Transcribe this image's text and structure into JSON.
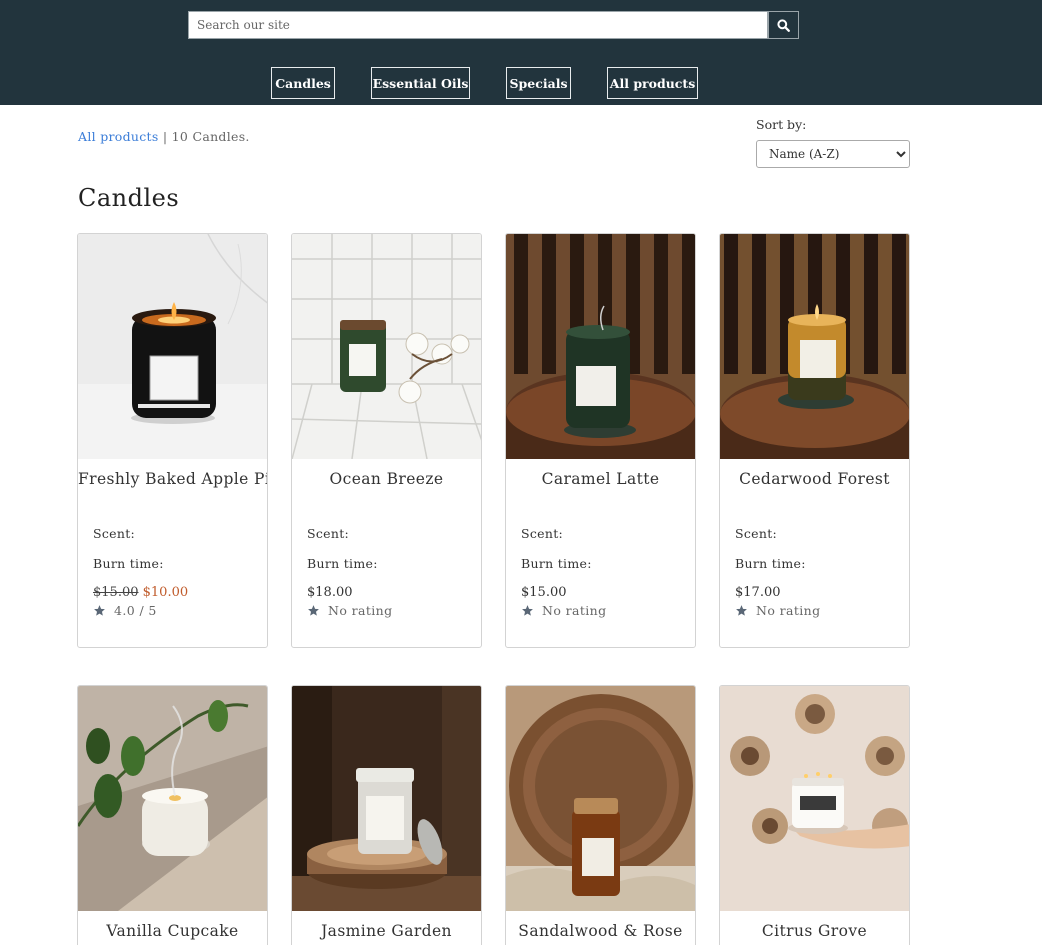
{
  "search": {
    "placeholder": "Search our site",
    "button_icon": "search-icon"
  },
  "nav": {
    "candles": "Candles",
    "essential_oils": "Essential Oils",
    "specials": "Specials",
    "all_products": "All products"
  },
  "breadcrumb": {
    "link": "All products",
    "separator": "|",
    "count_text": "10 Candles."
  },
  "sort": {
    "label": "Sort by:",
    "selected": "Name (A-Z)"
  },
  "page_title": "Candles",
  "labels": {
    "scent": "Scent:",
    "burn_time": "Burn time:"
  },
  "colors": {
    "header_bg": "#22343d",
    "link": "#3b7dd8",
    "sale_price": "#c05b2b"
  },
  "products": [
    {
      "name": "Freshly Baked Apple Pie",
      "old_price": "$15.00",
      "price": "$10.00",
      "rating": "4.0 / 5"
    },
    {
      "name": "Ocean Breeze",
      "price": "$18.00",
      "rating": "No rating"
    },
    {
      "name": "Caramel Latte",
      "price": "$15.00",
      "rating": "No rating"
    },
    {
      "name": "Cedarwood Forest",
      "price": "$17.00",
      "rating": "No rating"
    },
    {
      "name": "Vanilla Cupcake"
    },
    {
      "name": "Jasmine Garden"
    },
    {
      "name": "Sandalwood & Rose"
    },
    {
      "name": "Citrus Grove"
    }
  ]
}
